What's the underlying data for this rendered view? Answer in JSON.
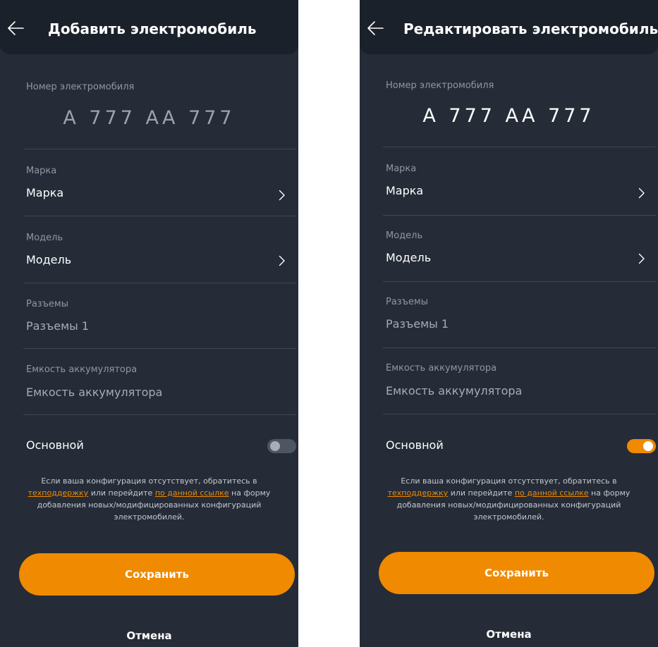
{
  "colors": {
    "background": "#252c37",
    "header": "#1b212a",
    "accent": "#f08a00",
    "label": "#8f97a3",
    "toggle_off": "#4e5663"
  },
  "icons": {
    "back": "arrow-left-icon",
    "chevron": "chevron-right-icon"
  },
  "add_screen": {
    "title": "Добавить электромобиль",
    "plate_label": "Номер электромобиля",
    "plate_value": "А 777 АА 777",
    "brand_label": "Марка",
    "brand_value": "Марка",
    "model_label": "Модель",
    "model_value": "Модель",
    "connectors_label": "Разъемы",
    "connectors_value": "Разъемы 1",
    "battery_label": "Емкость аккумулятора",
    "battery_placeholder": "Емкость аккумулятора",
    "main_label": "Основной",
    "main_enabled": false,
    "info_part1": "Если ваша конфигурация отсутствует, обратитесь в ",
    "info_link_support": "техподдержку",
    "info_part2": " или перейдите ",
    "info_link_form": "по данной ссылке",
    "info_part3": " на форму добавления новых/модифицированных конфигураций электромобилей.",
    "save_label": "Сохранить",
    "cancel_label": "Отмена"
  },
  "edit_screen": {
    "title": "Редактировать электромобиль",
    "plate_label": "Номер электромобиля",
    "plate_value": "А 777 АА 777",
    "brand_label": "Марка",
    "brand_value": "Марка",
    "model_label": "Модель",
    "model_value": "Модель",
    "connectors_label": "Разъемы",
    "connectors_value": "Разъемы 1",
    "battery_label": "Емкость аккумулятора",
    "battery_placeholder": "Емкость аккумулятора",
    "main_label": "Основной",
    "main_enabled": true,
    "info_part1": "Если ваша конфигурация отсутствует, обратитесь в ",
    "info_link_support": "техподдержку",
    "info_part2": " или перейдите ",
    "info_link_form": "по данной ссылке",
    "info_part3": " на форму добавления новых/модифицированных конфигураций электромобилей.",
    "save_label": "Сохранить",
    "cancel_label": "Отмена"
  }
}
